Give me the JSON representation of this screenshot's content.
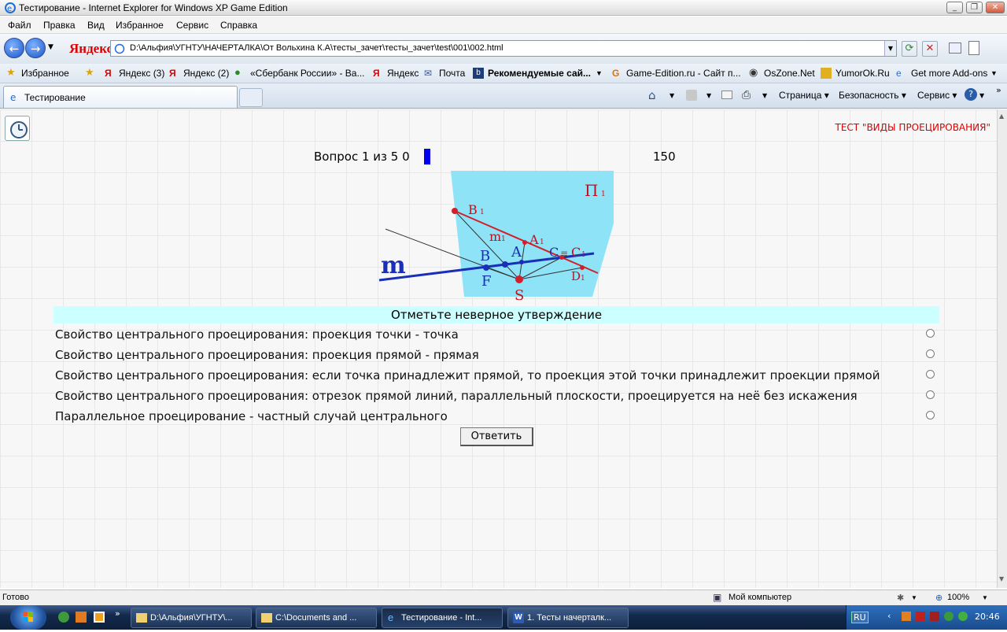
{
  "window": {
    "title": "Тестирование - Internet Explorer for Windows XP Game Edition"
  },
  "menu": [
    "Файл",
    "Правка",
    "Вид",
    "Избранное",
    "Сервис",
    "Справка"
  ],
  "toolbar": {
    "brand": "Яндекс",
    "url": "D:\\Альфия\\УГНТУ\\НАЧЕРТАЛКА\\От Вольхина К.А\\тесты_зачет\\тесты_зачет\\test\\001\\002.html"
  },
  "favorites": {
    "label": "Избранное",
    "items": [
      "Яндекс (3)",
      "Яндекс (2)",
      "«Сбербанк России» - Ва...",
      "Яндекс",
      "Почта",
      "Рекомендуемые сай...",
      "Game-Edition.ru - Сайт п...",
      "OsZone.Net",
      "YumorOk.Ru",
      "Get more Add-ons"
    ]
  },
  "tabs": [
    {
      "label": "Тестирование"
    }
  ],
  "commands": [
    "Страница",
    "Безопасность",
    "Сервис"
  ],
  "test": {
    "title": "ТЕСТ \"ВИДЫ ПРОЕЦИРОВАНИЯ\"",
    "question_label": "Вопрос 1 из 5",
    "score": "0",
    "timer": "150",
    "prompt": "Отметьте неверное утверждение",
    "options": [
      "Свойство центрального проецирования: проекция точки - точка",
      "Свойство центрального проецирования: проекция прямой - прямая",
      "Свойство центрального проецирования: если точка принадлежит прямой, то проекция этой точки принадлежит проекции прямой",
      "Свойство центрального проецирования: отрезок прямой линий, параллельный плоскости, проецируется на неё без искажения",
      "Параллельное проецирование - частный случай центрального"
    ],
    "submit": "Ответить",
    "figure": {
      "plane": "П",
      "plane_sub": "1",
      "m": "m",
      "B": "B",
      "F": "F",
      "A": "A",
      "C": "C",
      "S": "S",
      "B1": "B",
      "A1": "A",
      "m1": "m",
      "C1": "C",
      "D1": "D",
      "equiv": "≡",
      "sub1": "1"
    }
  },
  "status": {
    "text": "Готово",
    "zone": "Мой компьютер",
    "zoom": "100%"
  },
  "taskbar": {
    "items": [
      "D:\\Альфия\\УГНТУ\\...",
      "C:\\Documents and ...",
      "Тестирование - Int...",
      "1. Тесты начерталк..."
    ],
    "lang": "RU",
    "time": "20:46"
  }
}
